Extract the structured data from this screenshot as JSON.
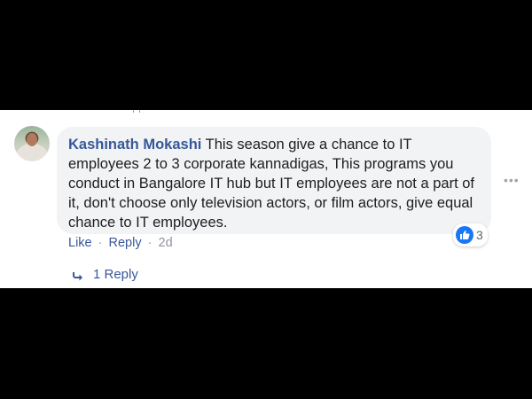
{
  "comment": {
    "author": "Kashinath Mokashi",
    "text": " This season give a chance to IT employees 2 to 3 corporate kannadigas, This programs you conduct in Bangalore IT hub but IT employees are not a part of it, don't choose only television actors, or film actors, give equal chance to IT employees.",
    "reaction_count": "3",
    "actions": {
      "like_label": "Like",
      "separator": "·",
      "reply_label": "Reply",
      "timestamp": "2d"
    },
    "replies_label": "1 Reply",
    "more_label": "•••"
  },
  "colors": {
    "author": "#365899",
    "link": "#385898",
    "bubble": "#f2f3f5",
    "like_blue": "#1877f2"
  },
  "icons": {
    "avatar": "profile-photo",
    "reaction": "like-thumb-icon",
    "reply": "reply-arrow-icon",
    "more": "more-options-icon"
  }
}
